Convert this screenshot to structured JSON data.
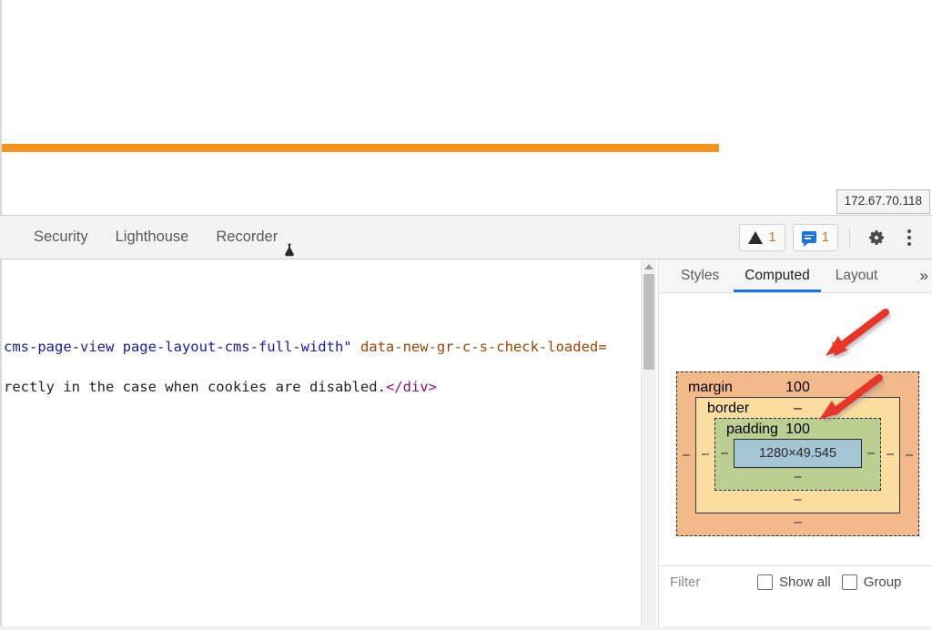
{
  "viewport": {
    "highlight_color": "#f7931e",
    "ip_tooltip": "172.67.70.118"
  },
  "devtools": {
    "tabs": [
      {
        "label": "Security",
        "icon": null
      },
      {
        "label": "Lighthouse",
        "icon": null
      },
      {
        "label": "Recorder",
        "icon": "flask-icon"
      }
    ],
    "counters": {
      "warning_icon": "warning-triangle-icon",
      "warning_count": "1",
      "message_icon": "message-icon",
      "message_count": "1",
      "count_color": "#c37a1a"
    },
    "settings_icon": "gear-icon",
    "more_icon": "kebab-menu-icon"
  },
  "elements_panel": {
    "line1": {
      "attr_value": "cms-page-view page-layout-cms-full-width\"",
      "attr_name": " data-new-gr-c-s-check-loaded="
    },
    "line2": {
      "text": "rectly in the case when cookies are disabled.",
      "tag": "</div>"
    }
  },
  "sidebar": {
    "tabs": [
      {
        "label": "Styles",
        "active": false
      },
      {
        "label": "Computed",
        "active": true
      },
      {
        "label": "Layout",
        "active": false
      }
    ],
    "overflow_label": "»",
    "active_tab_color": "#1a73e8",
    "box_model": {
      "margin": {
        "label": "margin",
        "top": "100",
        "right": "–",
        "bottom": "–",
        "left": "–",
        "color": "#f2b98a"
      },
      "border": {
        "label": "border",
        "top": "–",
        "right": "–",
        "bottom": "–",
        "left": "–",
        "color": "#fcdda0"
      },
      "padding": {
        "label": "padding",
        "top": "100",
        "right": "–",
        "bottom": "–",
        "left": "–",
        "color": "#bccf92"
      },
      "content": {
        "size": "1280×49.545",
        "color": "#a4c5d4"
      }
    },
    "annotations": {
      "arrow_color": "#e8342a",
      "arrow_count": 2
    },
    "filter_bar": {
      "filter_placeholder": "Filter",
      "show_all_label": "Show all",
      "group_label": "Group"
    }
  }
}
